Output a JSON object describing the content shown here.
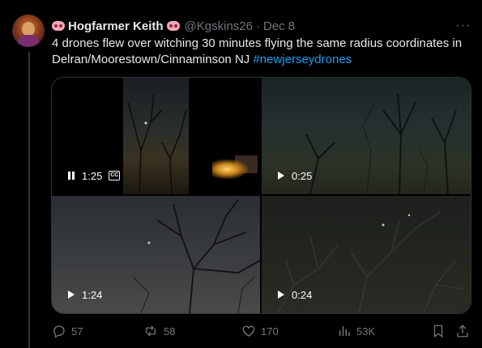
{
  "tweet": {
    "author_name": "Hogfarmer Keith",
    "handle": "@Kgskins26",
    "separator": "·",
    "date": "Dec 8",
    "more_glyph": "···",
    "text": "4 drones flew over witching 30 minutes flying the same radius coordinates in Delran/Moorestown/Cinnaminson NJ ",
    "hashtag": "#newjerseydrones"
  },
  "colors": {
    "background": "#000000",
    "text": "#e7e9ea",
    "muted": "#71767b",
    "link": "#1d9bf0"
  },
  "media": {
    "videos": [
      {
        "time": "1:25",
        "state": "playing",
        "control_icon": "pause-icon",
        "captions": true,
        "cc_label": "CC"
      },
      {
        "time": "0:25",
        "state": "paused",
        "control_icon": "play-icon",
        "captions": false
      },
      {
        "time": "1:24",
        "state": "paused",
        "control_icon": "play-icon",
        "captions": false
      },
      {
        "time": "0:24",
        "state": "paused",
        "control_icon": "play-icon",
        "captions": false
      }
    ]
  },
  "actions": {
    "replies": "57",
    "reposts": "58",
    "likes": "170",
    "views": "53K",
    "icons": [
      "reply-icon",
      "repost-icon",
      "like-icon",
      "views-icon",
      "bookmark-icon",
      "share-icon"
    ]
  }
}
